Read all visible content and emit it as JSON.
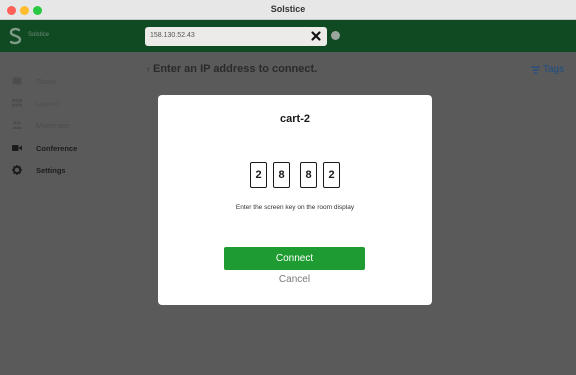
{
  "window": {
    "title": "Solstice"
  },
  "header": {
    "logo_text": "Solstice",
    "ip_value": "158.130.52.43",
    "clear_icon": "close-icon"
  },
  "sidebar": {
    "items": [
      {
        "label": "Share",
        "icon": "share-icon",
        "active": false
      },
      {
        "label": "Layout",
        "icon": "grid-icon",
        "active": false
      },
      {
        "label": "Moderator",
        "icon": "people-icon",
        "active": false
      },
      {
        "label": "Conference",
        "icon": "video-icon",
        "active": true
      },
      {
        "label": "Settings",
        "icon": "gear-icon",
        "active": true
      }
    ]
  },
  "main": {
    "hint": "Enter an IP address to connect.",
    "tags_label": "Tags"
  },
  "modal": {
    "title": "cart-2",
    "key_digits": [
      "2",
      "8",
      "8",
      "2"
    ],
    "instruction": "Enter the screen key on the room display",
    "connect_label": "Connect",
    "cancel_label": "Cancel"
  },
  "colors": {
    "header_bg": "#0f4a23",
    "connect_bg": "#1e9c32",
    "tags_color": "#1d4e86"
  }
}
